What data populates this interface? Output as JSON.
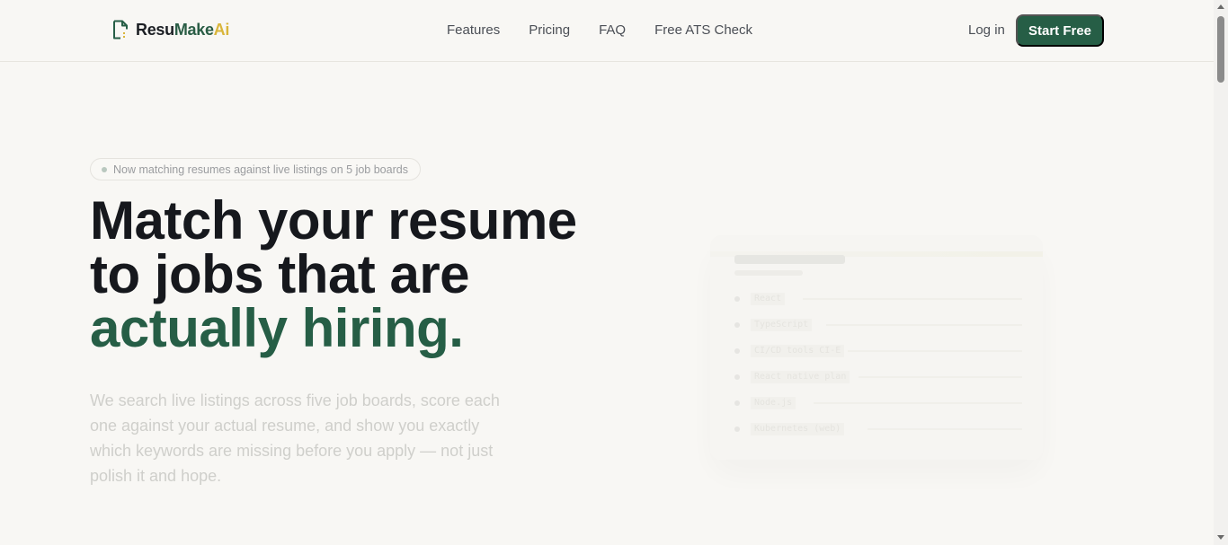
{
  "brand": {
    "resu": "Resu",
    "make": "Make",
    "ai": "Ai"
  },
  "nav": {
    "features": "Features",
    "pricing": "Pricing",
    "faq": "FAQ",
    "ats": "Free ATS Check"
  },
  "auth": {
    "login": "Log in",
    "start": "Start Free"
  },
  "hero": {
    "badge": "Now matching resumes against live listings on 5 job boards",
    "headline_line1": "Match your resume",
    "headline_line2": "to jobs that are",
    "headline_accent": "actually hiring.",
    "lead": "We search live listings across five job boards, score each one against your actual resume, and show you exactly which keywords are missing before you apply — not just polish it and hope."
  },
  "preview": {
    "items": [
      "React",
      "TypeScript",
      "CI/CD tools CI-E",
      "React native plan",
      "Node.js",
      "Kubernetes (web)"
    ]
  },
  "colors": {
    "accent": "#265e46",
    "ai_yellow": "#d9b53a",
    "background": "#f8f7f4"
  }
}
